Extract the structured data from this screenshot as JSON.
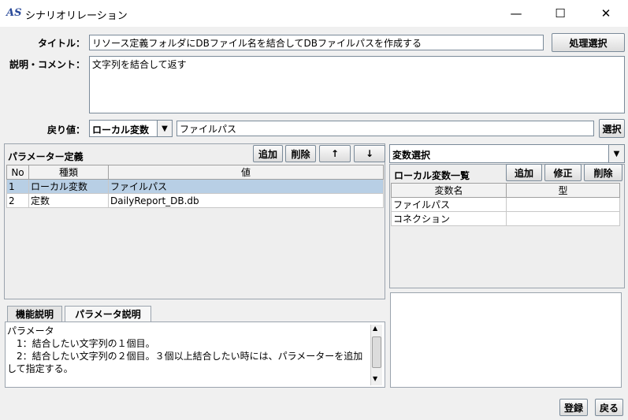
{
  "window": {
    "icon_text": "AS",
    "title": "シナリオリレーション",
    "minimize": "—",
    "maximize": "☐",
    "close": "✕"
  },
  "form": {
    "title_label": "タイトル：",
    "title_value": "リソース定義フォルダにDBファイル名を結合してDBファイルパスを作成する",
    "process_select": "処理選択",
    "comment_label": "説明・コメント：",
    "comment_value": "文字列を結合して返す",
    "return_label": "戻り値：",
    "return_type": "ローカル変数",
    "return_value": "ファイルパス",
    "select_button": "選択"
  },
  "params": {
    "title": "パラメーター定義",
    "add": "追加",
    "delete": "削除",
    "up": "↑",
    "down": "↓",
    "columns": [
      "No",
      "種類",
      "値"
    ],
    "rows": [
      {
        "no": "1",
        "kind": "ローカル変数",
        "value": "ファイルパス"
      },
      {
        "no": "2",
        "kind": "定数",
        "value": "DailyReport_DB.db"
      }
    ]
  },
  "tabs": [
    "機能説明",
    "パラメータ説明"
  ],
  "description_lines": [
    "パラメータ",
    "　1：結合したい文字列の１個目。",
    "　2：結合したい文字列の２個目。３個以上結合したい時には、パラメーターを追加",
    "して指定する。"
  ],
  "vars": {
    "select_label": "変数選択",
    "list_title": "ローカル変数一覧",
    "add": "追加",
    "edit": "修正",
    "delete": "削除",
    "columns": [
      "変数名",
      "型"
    ],
    "rows": [
      {
        "name": "ファイルパス",
        "type": ""
      },
      {
        "name": "コネクション",
        "type": ""
      }
    ]
  },
  "footer": {
    "register": "登録",
    "back": "戻る"
  }
}
